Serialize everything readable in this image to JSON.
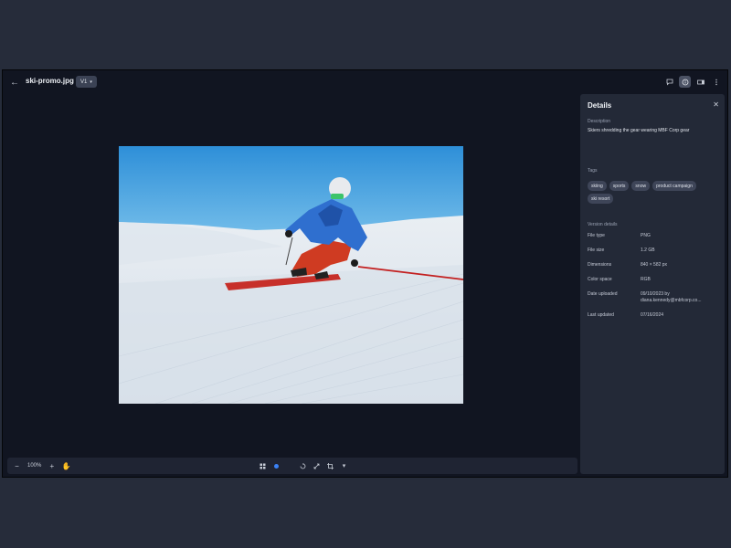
{
  "header": {
    "filename": "ski-promo.jpg",
    "version": "V1"
  },
  "icons": {
    "back": "arrow-left-icon",
    "comment": "comment-icon",
    "info": "info-icon",
    "panel": "panel-toggle-icon",
    "more": "more-vertical-icon"
  },
  "toolbar": {
    "zoom_out": "−",
    "zoom_level": "100%",
    "zoom_in": "+",
    "hand": "✋"
  },
  "details": {
    "title": "Details",
    "close": "✕",
    "description_label": "Description",
    "description": "Skiers shredding the gear wearing MBF Corp gear",
    "tags_label": "Tags",
    "tags": [
      "skiing",
      "sports",
      "snow",
      "product campaign",
      "ski resort"
    ],
    "version_label": "Version details",
    "rows": [
      {
        "k": "File type",
        "v": "PNG"
      },
      {
        "k": "File size",
        "v": "1.2 GB"
      },
      {
        "k": "Dimensions",
        "v": "840 × 582 px"
      },
      {
        "k": "Color space",
        "v": "RGB"
      },
      {
        "k": "Date uploaded",
        "v": "09/10/2023 by diana.kennedy@mbfcorp.co..."
      },
      {
        "k": "Last updated",
        "v": "07/16/2024"
      }
    ]
  },
  "colors": {
    "accent": "#3b82f6",
    "sky_top": "#2f8fd6",
    "jacket": "#2f67c8",
    "pants": "#c8321e"
  }
}
